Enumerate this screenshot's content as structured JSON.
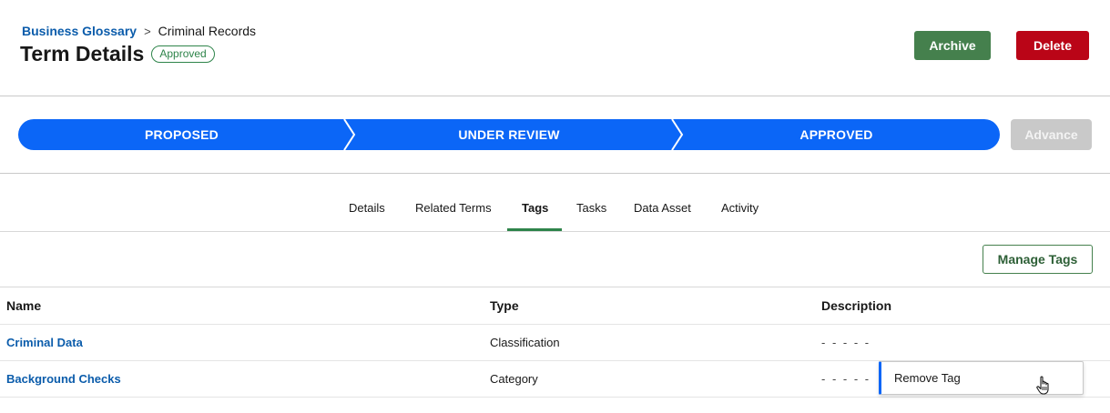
{
  "breadcrumb": {
    "parent": "Business Glossary",
    "separator": ">",
    "current": "Criminal Records"
  },
  "header": {
    "title": "Term Details",
    "status": "Approved"
  },
  "actions": {
    "archive": "Archive",
    "delete": "Delete"
  },
  "path": {
    "stages": [
      "PROPOSED",
      "UNDER REVIEW",
      "APPROVED"
    ],
    "advance": "Advance"
  },
  "tabs": [
    "Details",
    "Related Terms",
    "Tags",
    "Tasks",
    "Data Asset",
    "Activity"
  ],
  "active_tab": "Tags",
  "manage_tags": "Manage Tags",
  "table": {
    "columns": [
      "Name",
      "Type",
      "Description"
    ],
    "rows": [
      {
        "name": "Criminal Data",
        "type": "Classification",
        "description": "- - - - -"
      },
      {
        "name": "Background Checks",
        "type": "Category",
        "description": "- - - - -"
      }
    ]
  },
  "row_menu": {
    "item": "Remove Tag"
  },
  "colors": {
    "brand_blue": "#0b66f7",
    "archive_green": "#45804d",
    "delete_red": "#ba0517",
    "link_blue": "#0b5cab"
  }
}
